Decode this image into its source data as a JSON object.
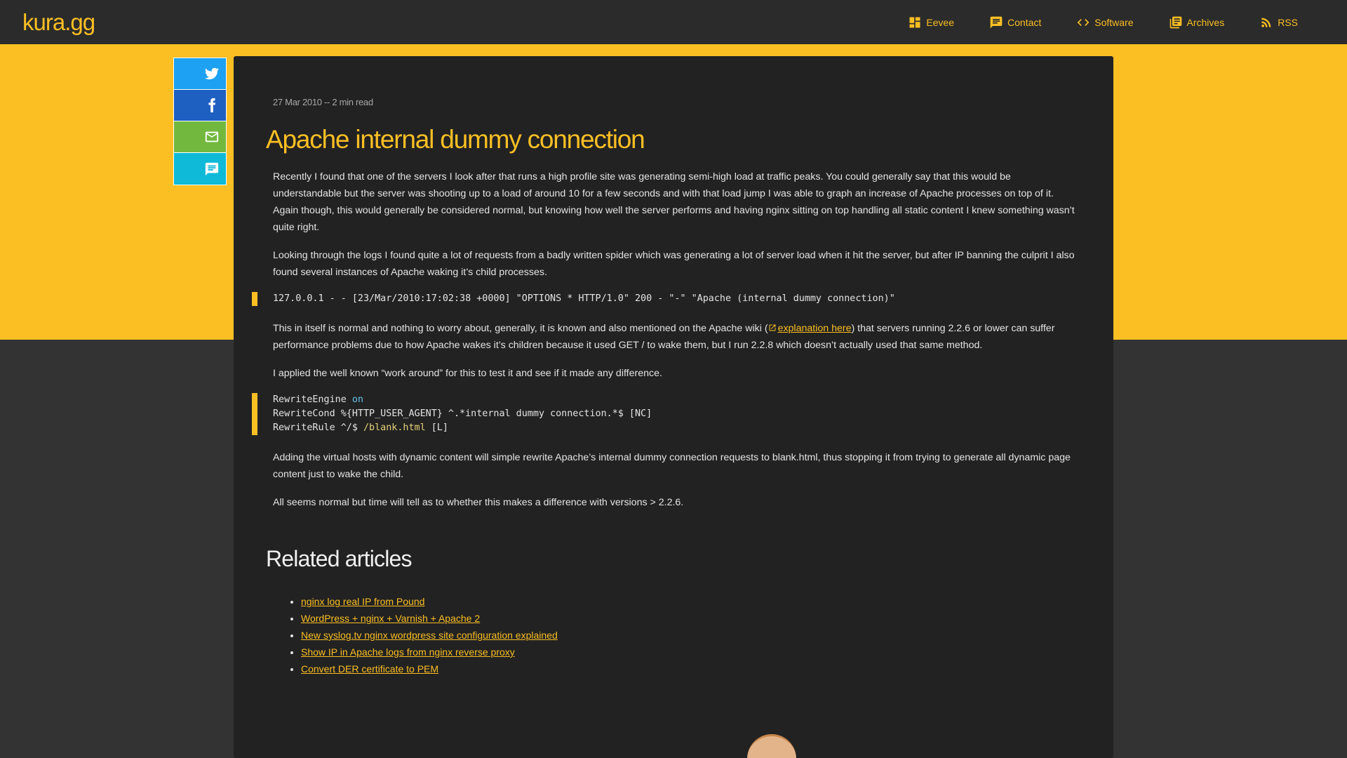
{
  "site": {
    "logo": "kura.gg",
    "nav": [
      {
        "label": "Eevee",
        "icon": "dashboard-icon"
      },
      {
        "label": "Contact",
        "icon": "chat-icon"
      },
      {
        "label": "Software",
        "icon": "code-icon"
      },
      {
        "label": "Archives",
        "icon": "library-icon"
      },
      {
        "label": "RSS",
        "icon": "rss-icon"
      }
    ]
  },
  "share": {
    "buttons": [
      "twitter-icon",
      "facebook-icon",
      "email-icon",
      "comment-icon"
    ],
    "colors": {
      "twitter": "#1da1f2",
      "facebook": "#1e5fc2",
      "email": "#72b83e",
      "comment": "#0fb9d8"
    }
  },
  "colors": {
    "accent": "#fbbf24",
    "header_bg": "#2b2b2b",
    "article_bg": "#222222",
    "page_bg": "#333333"
  },
  "post": {
    "meta": "27 Mar 2010 -- 2 min read",
    "title": "Apache internal dummy connection",
    "p1": "Recently I found that one of the servers I look after that runs a high profile site was generating semi-high load at traffic peaks. You could generally say that this would be understandable but the server was shooting up to a load of around 10 for a few seconds and with that load jump I was able to graph an increase of Apache processes on top of it. Again though, this would generally be considered normal, but knowing how well the server performs and having nginx sitting on top handling all static content I knew something wasn’t quite right.",
    "p2": "Looking through the logs I found quite a lot of requests from a badly written spider which was generating a lot of server load when it hit the server, but after IP banning the culprit I also found several instances of Apache waking it’s child processes.",
    "log_line": "127.0.0.1 - - [23/Mar/2010:17:02:38 +0000] \"OPTIONS * HTTP/1.0\" 200 - \"-\" \"Apache (internal dummy connection)\"",
    "p3_before": "This in itself is normal and nothing to worry about, generally, it is known and also mentioned on the Apache wiki (",
    "p3_link": "explanation here",
    "p3_after": ") that servers running 2.2.6 or lower can suffer performance problems due to how Apache wakes it’s children because it used GET / to wake them, but I run 2.2.8 which doesn’t actually used that same method.",
    "p4": "I applied the well known “work around” for this to test it and see if it made any difference.",
    "code": {
      "l1_a": "RewriteEngine ",
      "l1_b": "on",
      "l2": "RewriteCond %{HTTP_USER_AGENT} ^.*internal dummy connection.*$ [NC]",
      "l3_a": "RewriteRule ^/$ ",
      "l3_b": "/blank.html",
      "l3_c": " [L]"
    },
    "p5": "Adding the virtual hosts with dynamic content will simple rewrite Apache’s internal dummy connection requests to blank.html, thus stopping it from trying to generate all dynamic page content just to wake the child.",
    "p6": "All seems normal but time will tell as to whether this makes a difference with versions > 2.2.6."
  },
  "related": {
    "heading": "Related articles",
    "items": [
      "nginx log real IP from Pound",
      "WordPress + nginx + Varnish + Apache 2",
      "New syslog.tv nginx wordpress site configuration explained",
      "Show IP in Apache logs from nginx reverse proxy",
      "Convert DER certificate to PEM"
    ]
  }
}
